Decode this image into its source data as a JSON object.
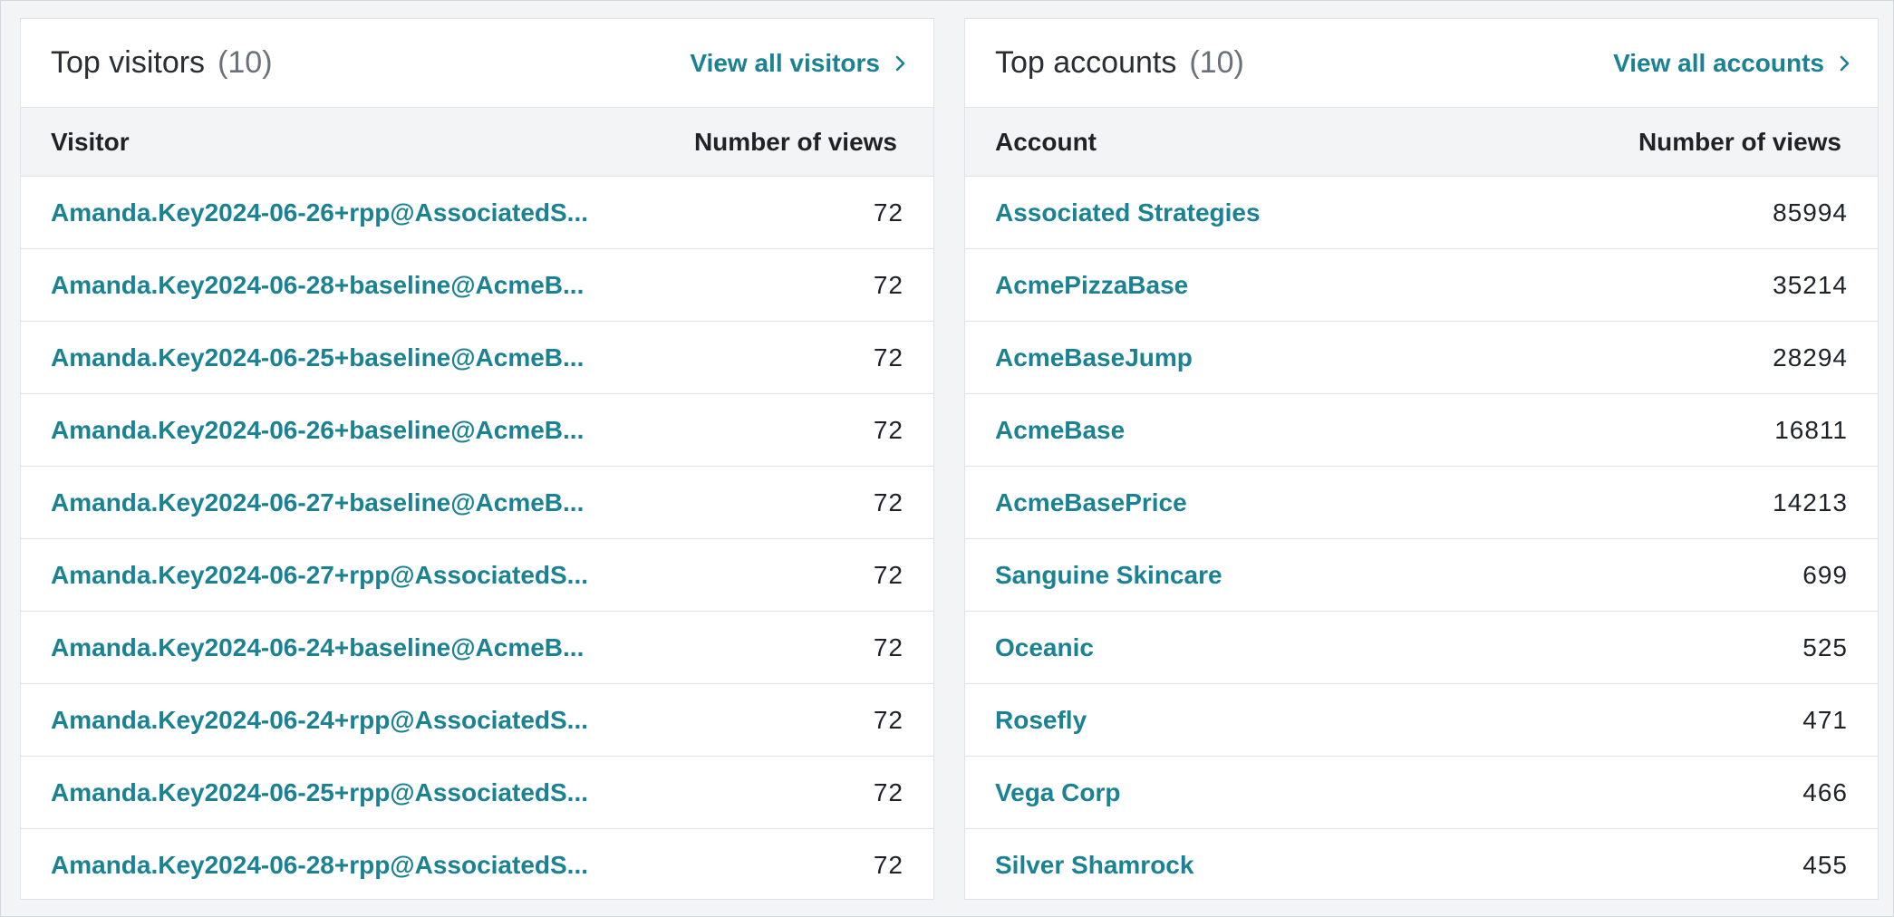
{
  "visitors": {
    "title": "Top visitors",
    "count": "(10)",
    "view_all_label": "View all visitors",
    "columns": [
      "Visitor",
      "Number of views"
    ],
    "rows": [
      {
        "name": "Amanda.Key2024-06-26+rpp@AssociatedS...",
        "views": "72"
      },
      {
        "name": "Amanda.Key2024-06-28+baseline@AcmeB...",
        "views": "72"
      },
      {
        "name": "Amanda.Key2024-06-25+baseline@AcmeB...",
        "views": "72"
      },
      {
        "name": "Amanda.Key2024-06-26+baseline@AcmeB...",
        "views": "72"
      },
      {
        "name": "Amanda.Key2024-06-27+baseline@AcmeB...",
        "views": "72"
      },
      {
        "name": "Amanda.Key2024-06-27+rpp@AssociatedS...",
        "views": "72"
      },
      {
        "name": "Amanda.Key2024-06-24+baseline@AcmeB...",
        "views": "72"
      },
      {
        "name": "Amanda.Key2024-06-24+rpp@AssociatedS...",
        "views": "72"
      },
      {
        "name": "Amanda.Key2024-06-25+rpp@AssociatedS...",
        "views": "72"
      },
      {
        "name": "Amanda.Key2024-06-28+rpp@AssociatedS...",
        "views": "72"
      }
    ]
  },
  "accounts": {
    "title": "Top accounts",
    "count": "(10)",
    "view_all_label": "View all accounts",
    "columns": [
      "Account",
      "Number of views"
    ],
    "rows": [
      {
        "name": "Associated Strategies",
        "views": "85994"
      },
      {
        "name": "AcmePizzaBase",
        "views": "35214"
      },
      {
        "name": "AcmeBaseJump",
        "views": "28294"
      },
      {
        "name": "AcmeBase",
        "views": "16811"
      },
      {
        "name": "AcmeBasePrice",
        "views": "14213"
      },
      {
        "name": "Sanguine Skincare",
        "views": "699"
      },
      {
        "name": "Oceanic",
        "views": "525"
      },
      {
        "name": "Rosefly",
        "views": "471"
      },
      {
        "name": "Vega Corp",
        "views": "466"
      },
      {
        "name": "Silver Shamrock",
        "views": "455"
      }
    ]
  },
  "icons": {
    "view_all": "chevron-right-icon"
  },
  "colors": {
    "link": "#1a8292",
    "header_bg": "#f3f4f6",
    "border": "#dfe2e7"
  }
}
